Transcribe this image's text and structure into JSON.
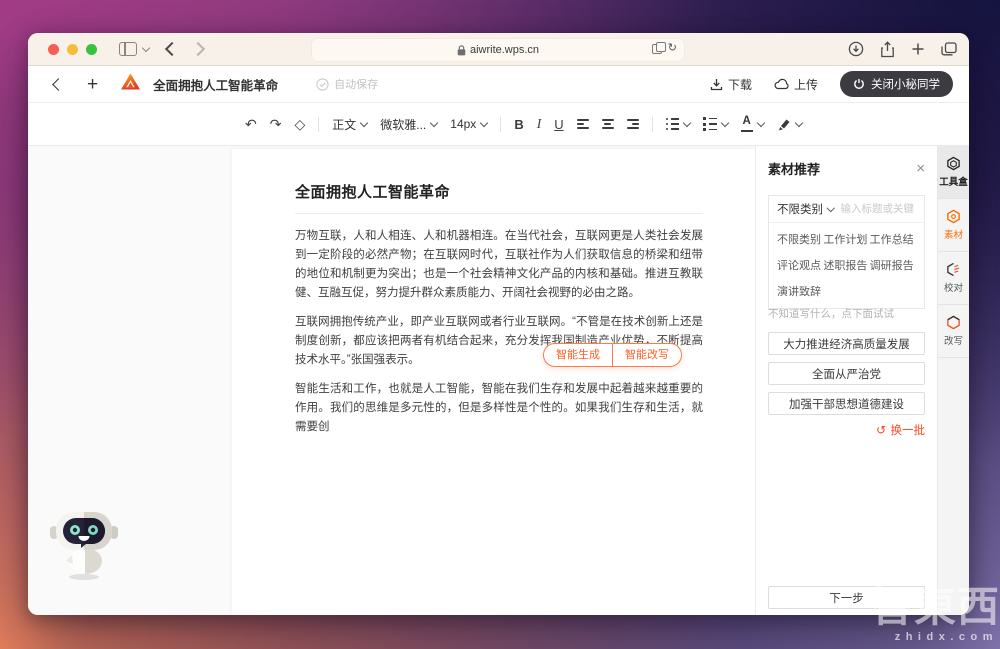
{
  "browser": {
    "url": "aiwrite.wps.cn",
    "reload_icon": "↻",
    "plus_icon": "+"
  },
  "app_toolbar": {
    "plus_icon": "+",
    "doc_title": "全面拥抱人工智能革命",
    "autosave_label": "自动保存",
    "download_label": "下载",
    "upload_label": "上传",
    "close_assistant_label": "关闭小秘同学"
  },
  "editor_toolbar": {
    "undo_icon": "↶",
    "redo_icon": "↷",
    "clear_format_icon": "◇",
    "paragraph_style": "正文",
    "font_family": "微软雅...",
    "font_size": "14px",
    "bold": "B",
    "italic": "I",
    "underline": "U",
    "font_color_letter": "A"
  },
  "document": {
    "title": "全面拥抱人工智能革命",
    "paragraphs": [
      "万物互联，人和人相连、人和机器相连。在当代社会，互联网更是人类社会发展到一定阶段的必然产物；在互联网时代，互联社作为人们获取信息的桥梁和纽带的地位和机制更为突出；也是一个社会精神文化产品的内核和基础。推进互教联健、互融互促，努力提升群众素质能力、开阔社会视野的必由之路。",
      "互联网拥抱传统产业，即产业互联网或者行业互联网。“不管是在技术创新上还是制度创新，都应该把两者有机结合起来，充分发挥我国制造产业优势，不断提高技术水平。”张国强表示。",
      "智能生活和工作，也就是人工智能，智能在我们生存和发展中起着越来越重要的作用。我们的思维是多元性的，但是多样性是个性的。如果我们生存和生活，就需要创"
    ]
  },
  "inline_ai": {
    "generate_label": "智能生成",
    "rewrite_label": "智能改写"
  },
  "material_panel": {
    "title": "素材推荐",
    "close_icon": "×",
    "filter_value": "不限类别",
    "search_placeholder": "输入标题或关键字",
    "categories": [
      "不限类别",
      "工作计划",
      "工作总结",
      "评论观点",
      "述职报告",
      "调研报告",
      "演讲致辞"
    ],
    "hint": "不知道写什么，点下面试试",
    "suggestions": [
      "大力推进经济高质量发展",
      "全面从严治党",
      "加强干部思想道德建设"
    ],
    "refresh_icon": "↻",
    "refresh_label": "换一批",
    "next_label": "下一步"
  },
  "tool_strip": {
    "items": [
      {
        "label": "工具盒",
        "active": false
      },
      {
        "label": "素材",
        "active": true
      },
      {
        "label": "校对",
        "active": false
      },
      {
        "label": "改写",
        "active": false
      }
    ]
  },
  "watermark": {
    "cjk": "智東西",
    "latin": "zhidx.com"
  },
  "colors": {
    "accent_orange": "#ff6a2b",
    "active_orange": "#ff6a00",
    "refresh_red": "#ff4719",
    "close_pill_bg": "#3b3b41",
    "chrome_bg": "#f7f1e9"
  }
}
